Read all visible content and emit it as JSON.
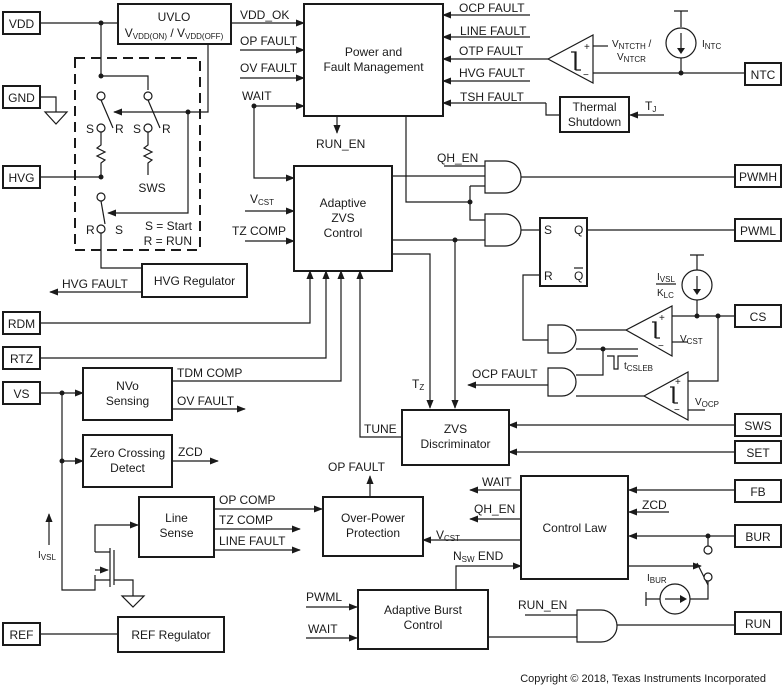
{
  "pins": {
    "vdd": "VDD",
    "gnd": "GND",
    "hvg": "HVG",
    "rdm": "RDM",
    "rtz": "RTZ",
    "vs": "VS",
    "ref": "REF",
    "ntc": "NTC",
    "pwmh": "PWMH",
    "pwml": "PWML",
    "cs": "CS",
    "sws": "SWS",
    "set": "SET",
    "fb": "FB",
    "bur": "BUR",
    "run": "RUN"
  },
  "blocks": {
    "uvlo": {
      "title": "UVLO",
      "v1": "V",
      "v1_sub": "VDD(ON)",
      "sep": " / ",
      "v2": "V",
      "v2_sub": "VDD(OFF)"
    },
    "power_fault": {
      "line1": "Power and",
      "line2": "Fault Management"
    },
    "adaptive_zvs": {
      "line1": "Adaptive",
      "line2": "ZVS",
      "line3": "Control"
    },
    "hvg_regulator": {
      "label": "HVG Regulator"
    },
    "thermal": {
      "line1": "Thermal",
      "line2": "Shutdown"
    },
    "nvo": {
      "line1": "NVo",
      "line2": "Sensing"
    },
    "zcd": {
      "line1": "Zero Crossing",
      "line2": "Detect"
    },
    "line_sense": {
      "line1": "Line",
      "line2": "Sense"
    },
    "opp": {
      "line1": "Over-Power",
      "line2": "Protection"
    },
    "zvs_disc": {
      "line1": "ZVS",
      "line2": "Discriminator"
    },
    "control_law": {
      "label": "Control Law"
    },
    "burst": {
      "line1": "Adaptive Burst",
      "line2": "Control"
    },
    "ref_regulator": {
      "label": "REF Regulator"
    },
    "sr_latch": {
      "s": "S",
      "r": "R",
      "q": "Q",
      "qbar": "Q"
    }
  },
  "signals": {
    "vdd_ok": "VDD_OK",
    "op_fault": "OP FAULT",
    "ov_fault": "OV FAULT",
    "wait": "WAIT",
    "ocp_fault": "OCP FAULT",
    "line_fault": "LINE FAULT",
    "otp_fault": "OTP FAULT",
    "hvg_fault": "HVG FAULT",
    "tsh_fault": "TSH FAULT",
    "run_en": "RUN_EN",
    "qh_en": "QH_EN",
    "v": "V",
    "cst_sub": "CST",
    "tz_comp": "TZ COMP",
    "tdm_comp": "TDM COMP",
    "zcd": "ZCD",
    "op_comp": "OP COMP",
    "tz": "T",
    "tz_sub": "Z",
    "tune": "TUNE",
    "tj": "T",
    "tj_sub": "J",
    "ntcth": "NTCTH",
    "ntcr": "NTCR",
    "ntc_slash": " /",
    "intc": "I",
    "intc_sub": "NTC",
    "ivsl": "I",
    "ivsl_sub": "VSL",
    "klc": "K",
    "klc_sub": "LC",
    "tcsleb": "t",
    "tcsleb_sub": "CSLEB",
    "vocp_sub": "OCP",
    "pwml": "PWML",
    "nsw": "N",
    "nsw_sub": "SW",
    "nsw_end": " END",
    "ibur": "I",
    "ibur_sub": "BUR",
    "sw_s": "S",
    "sw_r": "R",
    "sws": "SWS",
    "legend_s": "S = Start",
    "legend_r": "R = RUN",
    "plus": "+",
    "minus": "−"
  },
  "copyright": "Copyright © 2018, Texas Instruments Incorporated"
}
